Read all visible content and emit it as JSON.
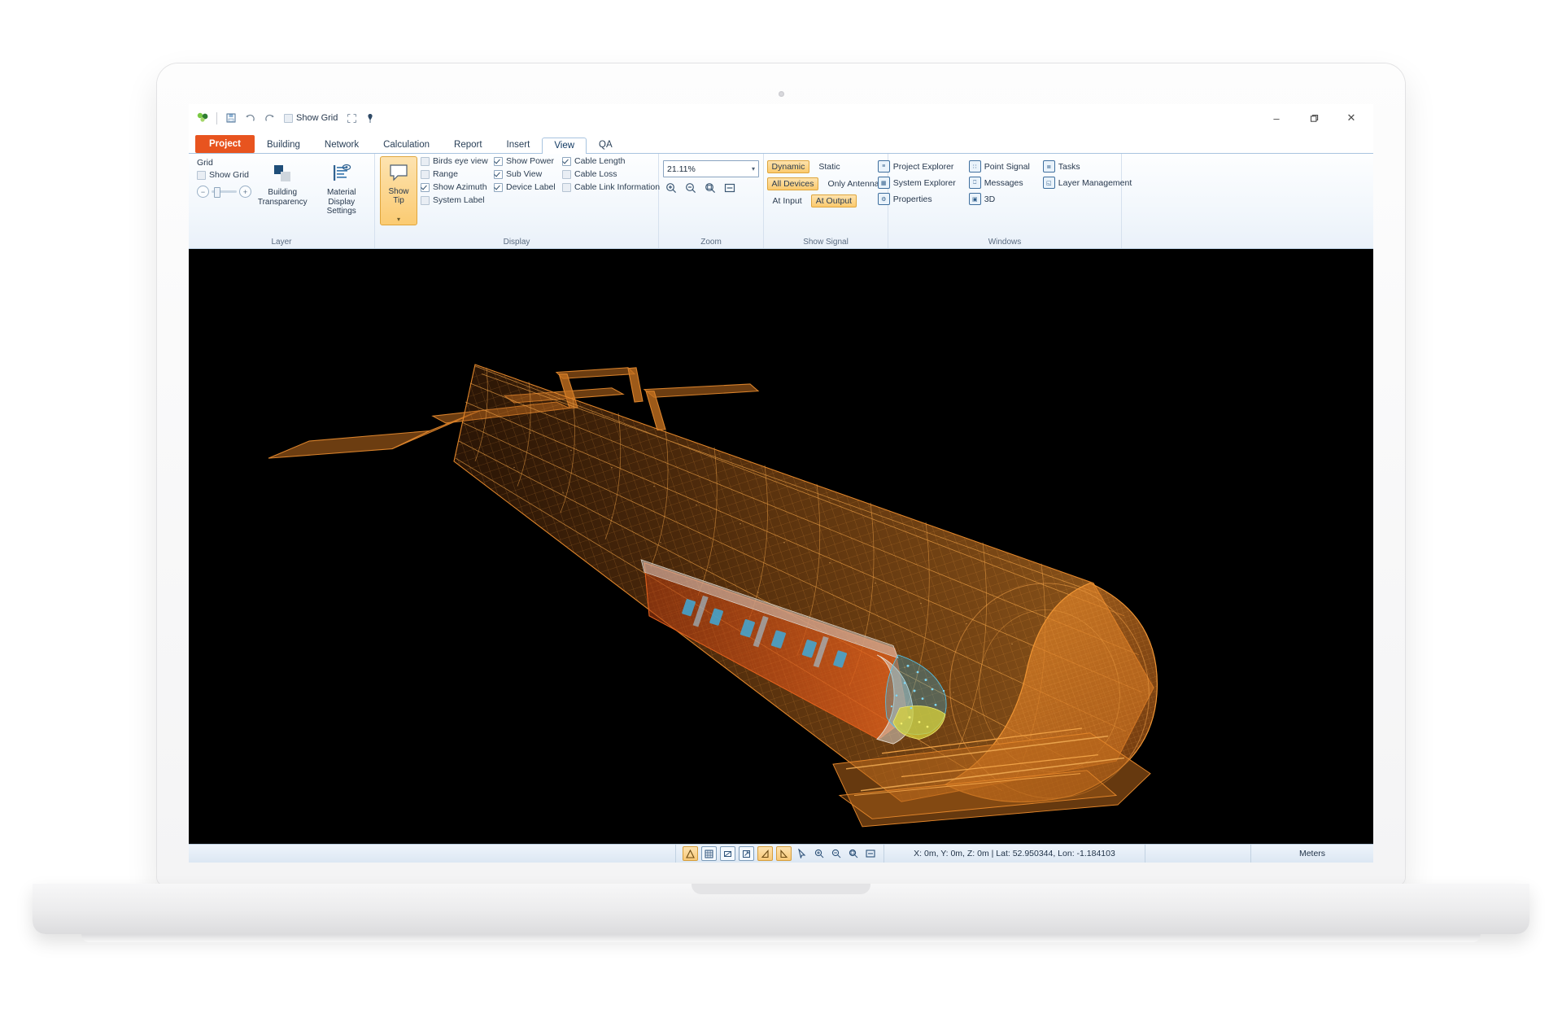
{
  "window": {
    "minimize_label": "–",
    "maximize_label": "❐",
    "close_label": "✕"
  },
  "quick_access": {
    "app_icon": "app-logo-icon",
    "items": [
      {
        "name": "save-icon",
        "glyph": "▣",
        "label": ""
      },
      {
        "name": "undo-icon",
        "glyph": "↶",
        "label": ""
      },
      {
        "name": "redo-icon",
        "glyph": "↷",
        "label": ""
      },
      {
        "name": "show-grid-toggle",
        "glyph": "▤",
        "label": "Show Grid"
      },
      {
        "name": "select-area-icon",
        "glyph": "⬚",
        "label": ""
      },
      {
        "name": "pin-icon",
        "glyph": "⚑",
        "label": ""
      }
    ]
  },
  "tabs": [
    {
      "id": "project",
      "label": "Project",
      "state": "brand"
    },
    {
      "id": "building",
      "label": "Building",
      "state": "normal"
    },
    {
      "id": "network",
      "label": "Network",
      "state": "normal"
    },
    {
      "id": "calculation",
      "label": "Calculation",
      "state": "normal"
    },
    {
      "id": "report",
      "label": "Report",
      "state": "normal"
    },
    {
      "id": "insert",
      "label": "Insert",
      "state": "normal"
    },
    {
      "id": "view",
      "label": "View",
      "state": "active"
    },
    {
      "id": "qa",
      "label": "QA",
      "state": "normal"
    }
  ],
  "ribbon": {
    "groups": [
      {
        "id": "layer",
        "label": "Layer"
      },
      {
        "id": "display",
        "label": "Display"
      },
      {
        "id": "zoom",
        "label": "Zoom"
      },
      {
        "id": "show_signal",
        "label": "Show Signal"
      },
      {
        "id": "windows",
        "label": "Windows"
      }
    ],
    "layer": {
      "grid_title": "Grid",
      "show_grid_label": "Show Grid",
      "show_grid_checked": false,
      "zoom_out_label": "−",
      "zoom_in_label": "+",
      "building_transparency": "Building Transparency",
      "material_display_settings": "Material Display Settings"
    },
    "display": {
      "show_tip_label": "Show Tip",
      "show_tip_active": true,
      "checkboxes": [
        {
          "label": "Birds eye view",
          "checked": false
        },
        {
          "label": "Range",
          "checked": false
        },
        {
          "label": "Show Azimuth",
          "checked": true
        },
        {
          "label": "System Label",
          "checked": false
        },
        {
          "label": "Show Power",
          "checked": true
        },
        {
          "label": "Sub View",
          "checked": true
        },
        {
          "label": "Device Label",
          "checked": true
        },
        {
          "label": "Cable Length",
          "checked": true
        },
        {
          "label": "Cable Loss",
          "checked": false
        },
        {
          "label": "Cable Link Information",
          "checked": false
        }
      ],
      "col1": [
        {
          "label": "Birds eye view",
          "checked": false
        },
        {
          "label": "Range",
          "checked": false
        },
        {
          "label": "Show Azimuth",
          "checked": true
        },
        {
          "label": "System Label",
          "checked": false
        }
      ],
      "col2": [
        {
          "label": "Show Power",
          "checked": true
        },
        {
          "label": "Sub View",
          "checked": true
        },
        {
          "label": "Device Label",
          "checked": true
        }
      ],
      "col3": [
        {
          "label": "Cable Length",
          "checked": true
        },
        {
          "label": "Cable Loss",
          "checked": false
        },
        {
          "label": "Cable Link Information",
          "checked": false
        }
      ]
    },
    "zoom": {
      "level": "21.11%",
      "dropdown_arrow": "▾",
      "buttons": [
        {
          "name": "zoom-in-icon",
          "glyph": "⊕"
        },
        {
          "name": "zoom-out-icon",
          "glyph": "⊖"
        },
        {
          "name": "zoom-selection-icon",
          "glyph": "⊚"
        },
        {
          "name": "zoom-fit-icon",
          "glyph": "⊟"
        }
      ]
    },
    "show_signal": {
      "rows": [
        {
          "left": {
            "label": "Dynamic",
            "active": true
          },
          "right": {
            "label": "Static",
            "active": false
          }
        },
        {
          "left": {
            "label": "All Devices",
            "active": true
          },
          "right": {
            "label": "Only Antenna",
            "active": false
          }
        },
        {
          "left": {
            "label": "At Input",
            "active": false
          },
          "right": {
            "label": "At Output",
            "active": true
          }
        }
      ]
    },
    "windows": {
      "items": [
        {
          "label": "Project Explorer",
          "icon": "project-explorer-icon",
          "glyph": "≡"
        },
        {
          "label": "Point Signal",
          "icon": "point-signal-icon",
          "glyph": "∷"
        },
        {
          "label": "Tasks",
          "icon": "tasks-icon",
          "glyph": "≣"
        },
        {
          "label": "System Explorer",
          "icon": "system-explorer-icon",
          "glyph": "▦"
        },
        {
          "label": "Messages",
          "icon": "messages-icon",
          "glyph": "❑"
        },
        {
          "label": "Layer Management",
          "icon": "layer-management-icon",
          "glyph": "◱"
        },
        {
          "label": "Properties",
          "icon": "properties-icon",
          "glyph": "⚙"
        },
        {
          "label": "3D",
          "icon": "threed-icon",
          "glyph": "▣"
        },
        {
          "label": "",
          "icon": "",
          "glyph": ""
        }
      ]
    }
  },
  "statusbar": {
    "tools": [
      {
        "name": "snap-vertex-icon",
        "glyph": "△",
        "active": true
      },
      {
        "name": "snap-grid-icon",
        "glyph": "⊞",
        "active": false
      },
      {
        "name": "snap-midpoint-icon",
        "glyph": "▢",
        "active": false
      },
      {
        "name": "snap-extend-icon",
        "glyph": "↗",
        "active": false
      },
      {
        "name": "snap-angle-icon",
        "glyph": "◢",
        "active": true
      },
      {
        "name": "snap-perpendicular-icon",
        "glyph": "◣",
        "active": true
      },
      {
        "name": "pointer-icon",
        "glyph": "↖",
        "active": false
      },
      {
        "name": "zoom-in-icon",
        "glyph": "⊕",
        "active": false
      },
      {
        "name": "zoom-out-icon",
        "glyph": "⊖",
        "active": false
      },
      {
        "name": "zoom-window-icon",
        "glyph": "⊚",
        "active": false
      },
      {
        "name": "zoom-extents-icon",
        "glyph": "⊟",
        "active": false
      }
    ],
    "coordinates": "X: 0m, Y: 0m, Z: 0m | Lat: 52.950344, Lon: -1.184103",
    "units": "Meters"
  },
  "viewport": {
    "background": "#000000",
    "model_color": "#E07A24",
    "accent_color": "#D34A12",
    "highlight_color": "#4FC3F7"
  }
}
